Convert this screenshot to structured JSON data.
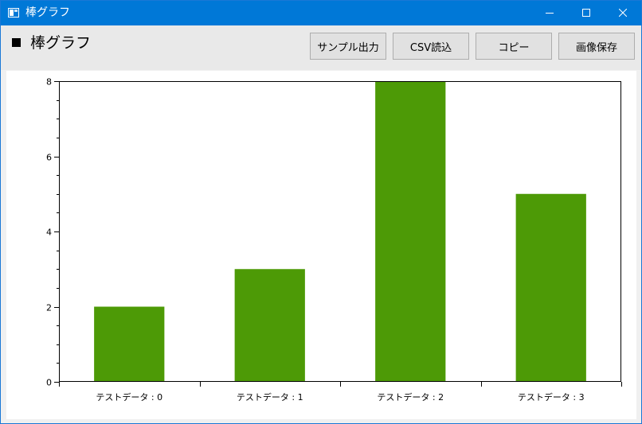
{
  "window": {
    "title": "棒グラフ",
    "controls": {
      "minimize": "minimize",
      "maximize": "maximize",
      "close": "close"
    },
    "colors": {
      "titlebar": "#0078d7",
      "bar": "#4d9a06"
    }
  },
  "toolbar": {
    "heading": "棒グラフ",
    "buttons": {
      "sample_output": "サンプル出力",
      "csv_load": "CSV読込",
      "copy": "コピー",
      "save_image": "画像保存"
    }
  },
  "chart_data": {
    "type": "bar",
    "categories": [
      "テストデータ : 0",
      "テストデータ : 1",
      "テストデータ : 2",
      "テストデータ : 3"
    ],
    "values": [
      2,
      3,
      8,
      5
    ],
    "ylim": [
      0,
      8
    ],
    "yticks_major": [
      0,
      2,
      4,
      6,
      8
    ],
    "yticks_minor_step": 0.5,
    "grid": false,
    "color": "#4d9a06"
  }
}
